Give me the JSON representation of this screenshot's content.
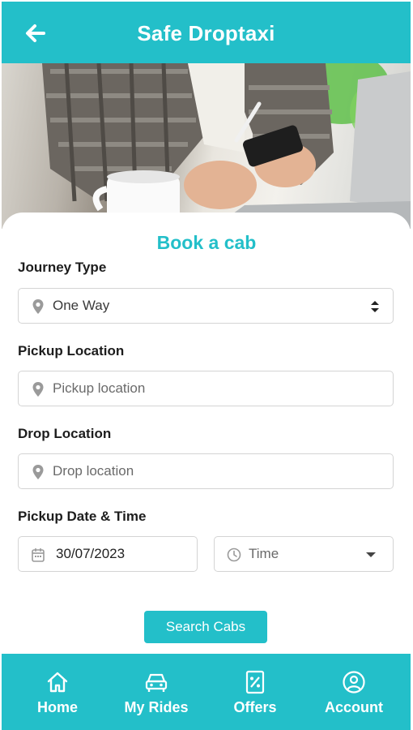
{
  "header": {
    "title": "Safe Droptaxi",
    "back_icon": "arrow-left-icon"
  },
  "hero": {
    "image": "person-using-phone-at-desk-photo"
  },
  "booking_form": {
    "title": "Book a cab",
    "journey_type": {
      "label": "Journey Type",
      "value": "One Way",
      "icon": "location-pin-icon"
    },
    "pickup_location": {
      "label": "Pickup Location",
      "placeholder": "Pickup location",
      "icon": "location-pin-icon"
    },
    "drop_location": {
      "label": "Drop Location",
      "placeholder": "Drop location",
      "icon": "location-pin-icon"
    },
    "pickup_datetime": {
      "label": "Pickup Date & Time",
      "date_value": "30/07/2023",
      "time_placeholder": "Time",
      "date_icon": "calendar-icon",
      "time_icon": "clock-icon"
    },
    "search_button": "Search Cabs"
  },
  "bottom_nav": {
    "items": [
      {
        "label": "Home",
        "icon": "home-icon"
      },
      {
        "label": "My Rides",
        "icon": "car-icon"
      },
      {
        "label": "Offers",
        "icon": "percent-tag-icon"
      },
      {
        "label": "Account",
        "icon": "user-circle-icon"
      }
    ]
  },
  "colors": {
    "accent": "#23bfc9",
    "text_dark": "#1d1d1d",
    "border": "#d4d4d4"
  }
}
